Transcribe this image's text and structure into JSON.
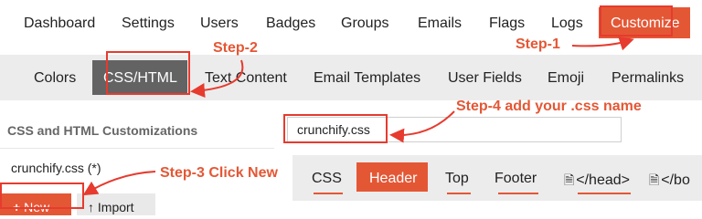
{
  "top_nav": {
    "items": [
      "Dashboard",
      "Settings",
      "Users",
      "Badges",
      "Groups",
      "Emails",
      "Flags",
      "Logs"
    ],
    "active": "Customize"
  },
  "sub_nav": {
    "items": [
      "Colors",
      "Text Content",
      "Email Templates",
      "User Fields",
      "Emoji",
      "Permalinks"
    ],
    "active": "CSS/HTML"
  },
  "left_panel": {
    "title": "CSS and HTML Customizations",
    "items": [
      "crunchify.css (*)"
    ],
    "new_button": "New",
    "import_button": "Import"
  },
  "name_field": {
    "value": "crunchify.css"
  },
  "editor_tabs": {
    "items": [
      "CSS",
      "Header",
      "Top",
      "Footer",
      "</head>",
      "</bo"
    ],
    "active": "Header"
  },
  "annotations": {
    "step1": "Step-1",
    "step2": "Step-2",
    "step3": "Step-3 Click New",
    "step4": "Step-4 add your .css name"
  },
  "colors": {
    "accent": "#e45735",
    "annotation": "#e63b2e",
    "active_gray": "#636363"
  }
}
